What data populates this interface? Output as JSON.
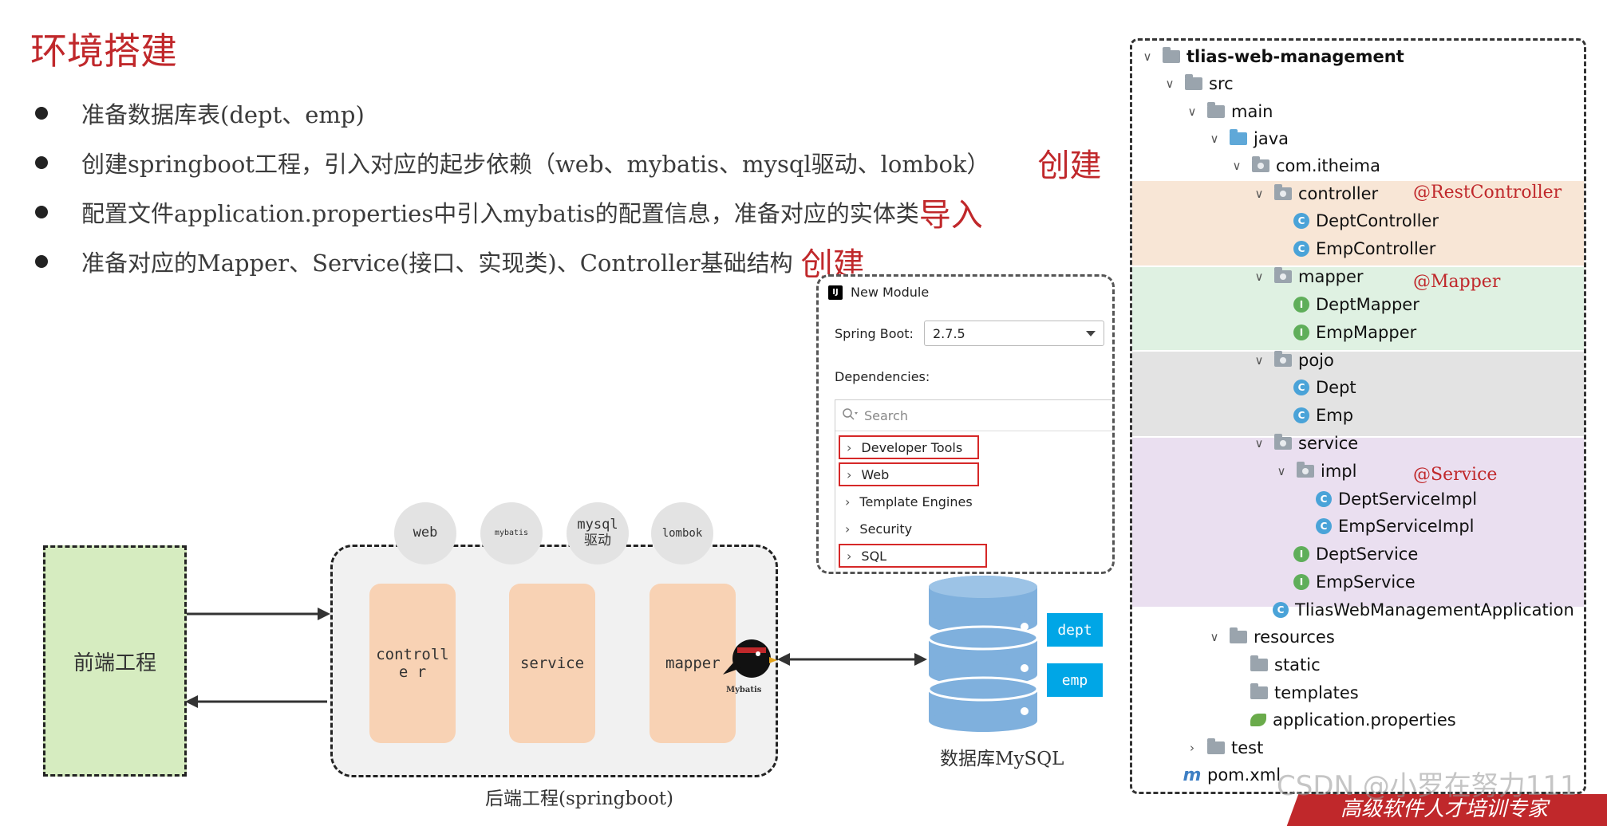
{
  "title": "环境搭建",
  "bullets": [
    {
      "text": "准备数据库表(dept、emp)",
      "tag": ""
    },
    {
      "text": "创建springboot工程，引入对应的起步依赖（web、mybatis、mysql驱动、lombok）",
      "tag": "创建"
    },
    {
      "text": "配置文件application.properties中引入mybatis的配置信息，准备对应的实体类",
      "tag": "导入"
    },
    {
      "text": "准备对应的Mapper、Service(接口、实现类)、Controller基础结构",
      "tag": "创建"
    }
  ],
  "diagram": {
    "frontend_label": "前端工程",
    "backend_caption": "后端工程(springboot)",
    "deps": [
      "web",
      "mybatis",
      "mysql\n驱动",
      "lombok"
    ],
    "layers": [
      "controlle r",
      "service",
      "mapper"
    ],
    "mybatis_logo_text": "Mybatis",
    "db_caption": "数据库MySQL",
    "tables": [
      "dept",
      "emp"
    ]
  },
  "new_module": {
    "title": "New Module",
    "spring_boot_label": "Spring Boot:",
    "spring_boot_version": "2.7.5",
    "dependencies_label": "Dependencies:",
    "search_placeholder": "Search",
    "items": [
      "Developer Tools",
      "Web",
      "Template Engines",
      "Security",
      "SQL"
    ],
    "highlighted": [
      "Developer Tools",
      "Web",
      "SQL"
    ]
  },
  "tree": {
    "root": "tlias-web-management",
    "nodes": {
      "src": "src",
      "main": "main",
      "java": "java",
      "pkg": "com.itheima",
      "controller": "controller",
      "dept_controller": "DeptController",
      "emp_controller": "EmpController",
      "mapper": "mapper",
      "dept_mapper": "DeptMapper",
      "emp_mapper": "EmpMapper",
      "pojo": "pojo",
      "dept": "Dept",
      "emp": "Emp",
      "service": "service",
      "impl": "impl",
      "dept_service_impl": "DeptServiceImpl",
      "emp_service_impl": "EmpServiceImpl",
      "dept_service": "DeptService",
      "emp_service": "EmpService",
      "app": "TliasWebManagementApplication",
      "resources": "resources",
      "static": "static",
      "templates": "templates",
      "app_props": "application.properties",
      "test": "test",
      "pom": "pom.xml"
    },
    "annotations": {
      "controller": "@RestController",
      "mapper": "@Mapper",
      "service": "@Service"
    },
    "band_colors": {
      "controller": "#f8e6d6",
      "mapper": "#dff1e2",
      "pojo": "#e3e3e3",
      "service": "#eadff0"
    }
  },
  "watermark": "CSDN @小罗在努力111",
  "footer": "高级软件人才培训专家"
}
